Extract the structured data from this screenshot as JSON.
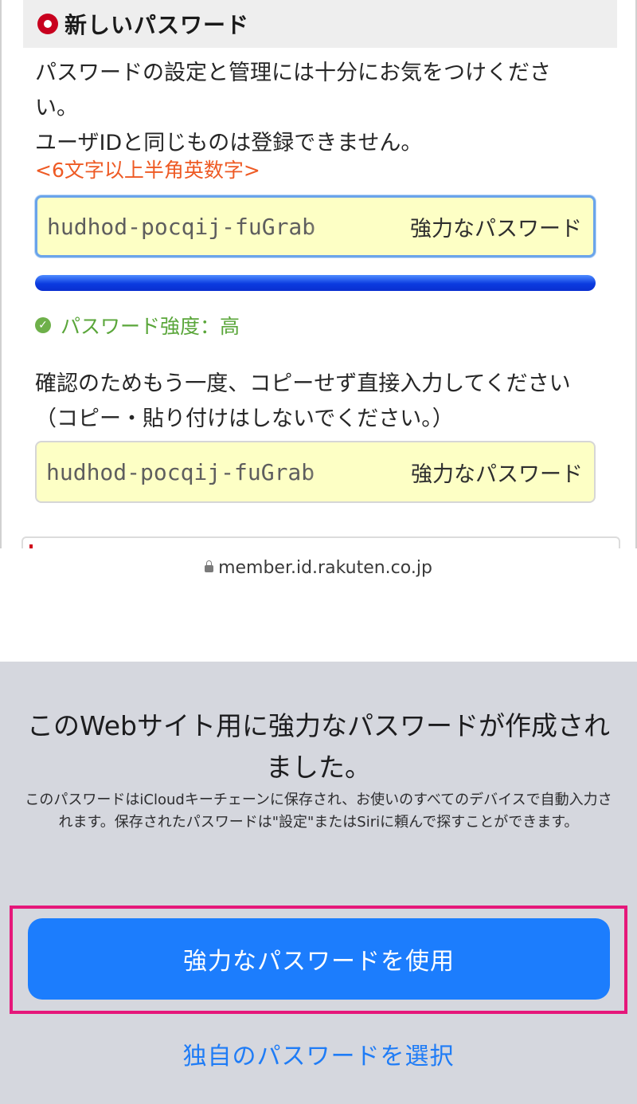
{
  "section": {
    "title": "新しいパスワード"
  },
  "description": {
    "line1": "パスワードの設定と管理には十分にお気をつけください。",
    "line2": "ユーザIDと同じものは登録できません。",
    "hint": "<6文字以上半角英数字>"
  },
  "password_field": {
    "value": "hudhod-pocqij-fuGrab",
    "badge": "強力なパスワード"
  },
  "strength": {
    "label": "パスワード強度：高",
    "level": "high",
    "fill_fraction": 1.0,
    "color": "#1a4bf0"
  },
  "confirm": {
    "description": "確認のためもう一度、コピーせず直接入力してください（コピー・貼り付けはしないでください。）",
    "value": "hudhod-pocqij-fuGrab",
    "badge": "強力なパスワード"
  },
  "browser": {
    "url": "member.id.rakuten.co.jp",
    "lock_icon": "lock-icon"
  },
  "sheet": {
    "title": "このWebサイト用に強力なパスワードが作成されました。",
    "body": "このパスワードはiCloudキーチェーンに保存され、お使いのすべてのデバイスで自動入力されます。保存されたパスワードは\"設定\"またはSiriに頼んで探すことができます。",
    "primary_button": "強力なパスワードを使用",
    "secondary_button": "独自のパスワードを選択",
    "accent_color": "#1c7dfd",
    "highlight_color": "#e5177a"
  }
}
